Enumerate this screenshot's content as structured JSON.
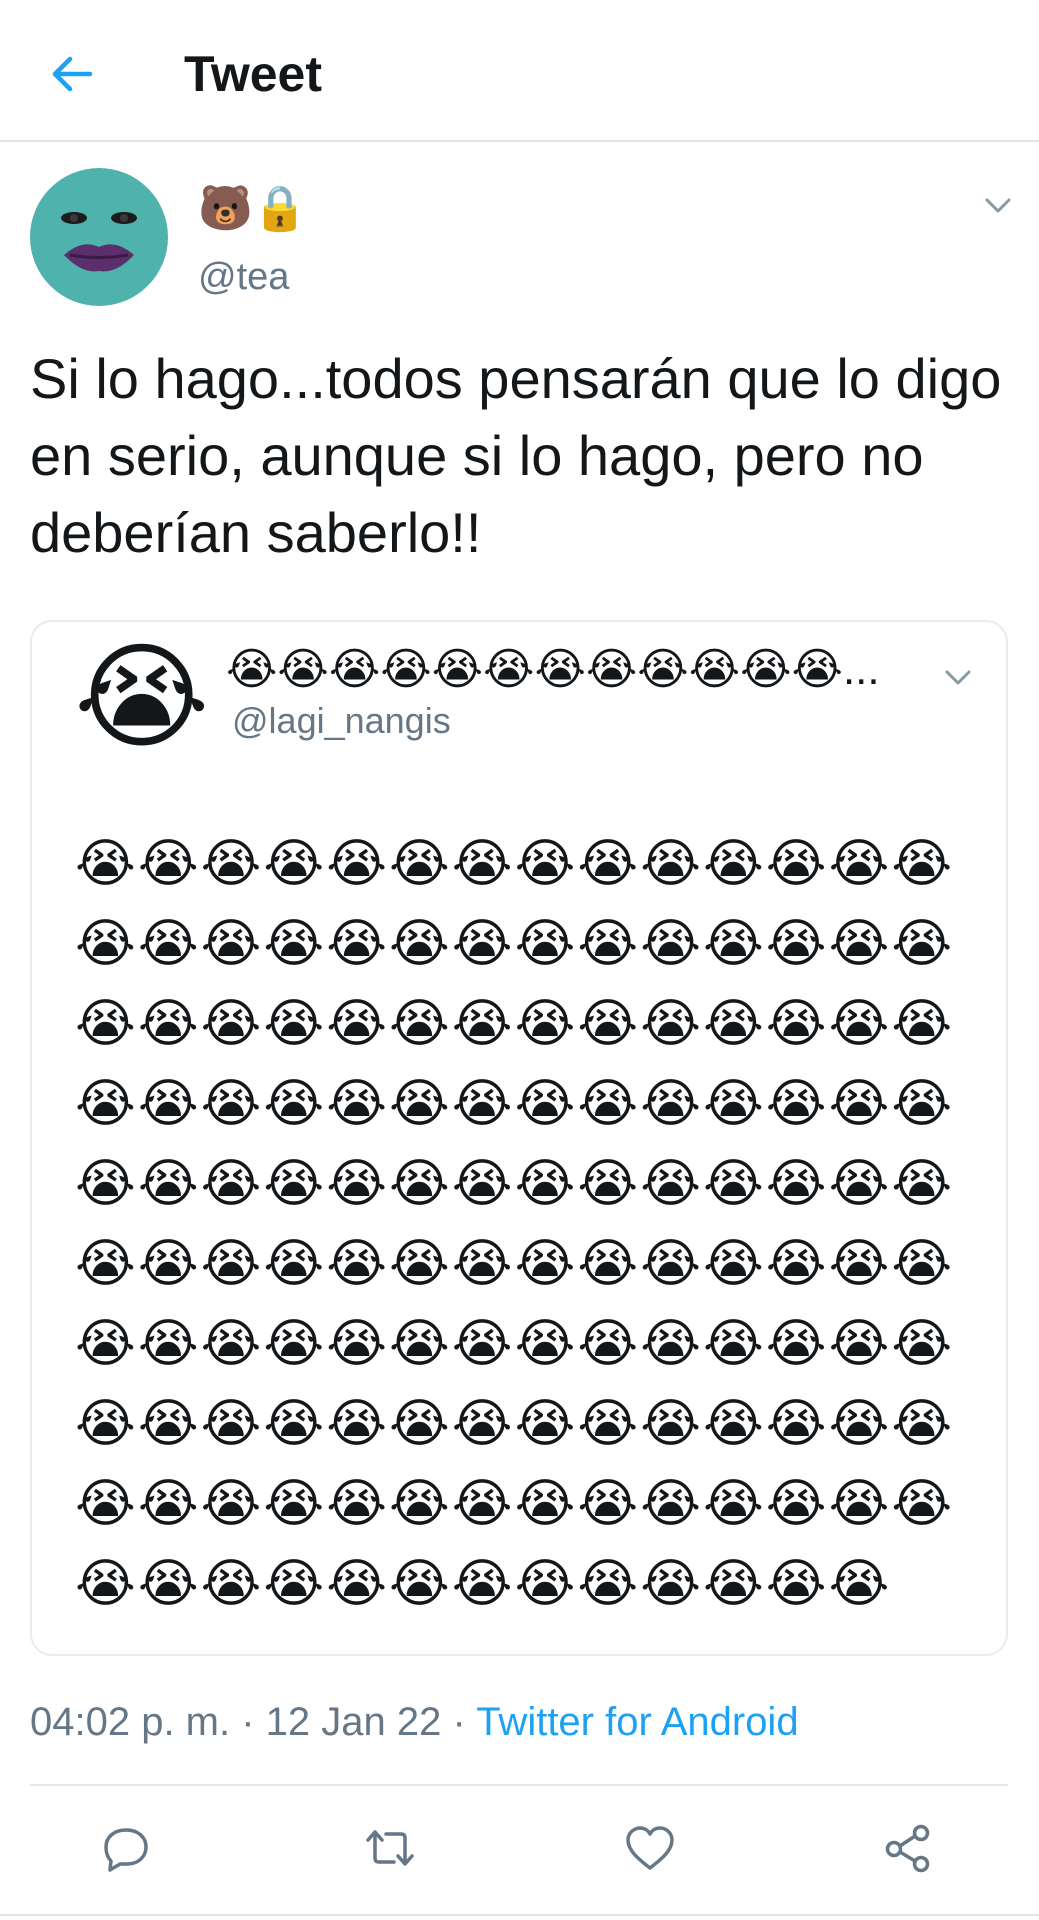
{
  "header": {
    "title": "Tweet",
    "back_icon": "arrow-left-icon"
  },
  "tweet": {
    "display_name": "🐻🔒",
    "handle": "@tea",
    "text": "Si lo hago...todos pensarán que lo digo en serio, aunque si lo hago, pero no deberían saberlo!!",
    "timestamp": "04:02 p. m. · 12 Jan 22 · ",
    "source": "Twitter for Android"
  },
  "quoted": {
    "avatar_emoji": "😭",
    "display_name": "😭😭😭😭😭😭😭😭😭😭😭😭...",
    "handle": "@lagi_nangis",
    "grid_emoji": "😭",
    "grid_columns": 14,
    "grid_total": 139
  },
  "actions": [
    {
      "name": "reply",
      "icon": "reply-icon"
    },
    {
      "name": "retweet",
      "icon": "retweet-icon"
    },
    {
      "name": "like",
      "icon": "heart-icon"
    },
    {
      "name": "share",
      "icon": "share-icon"
    }
  ],
  "colors": {
    "accent": "#1da1f2",
    "secondary_text": "#657786",
    "primary_text": "#14171a",
    "border": "#e1e8ed",
    "avatar_bg": "#4fb2ad"
  }
}
